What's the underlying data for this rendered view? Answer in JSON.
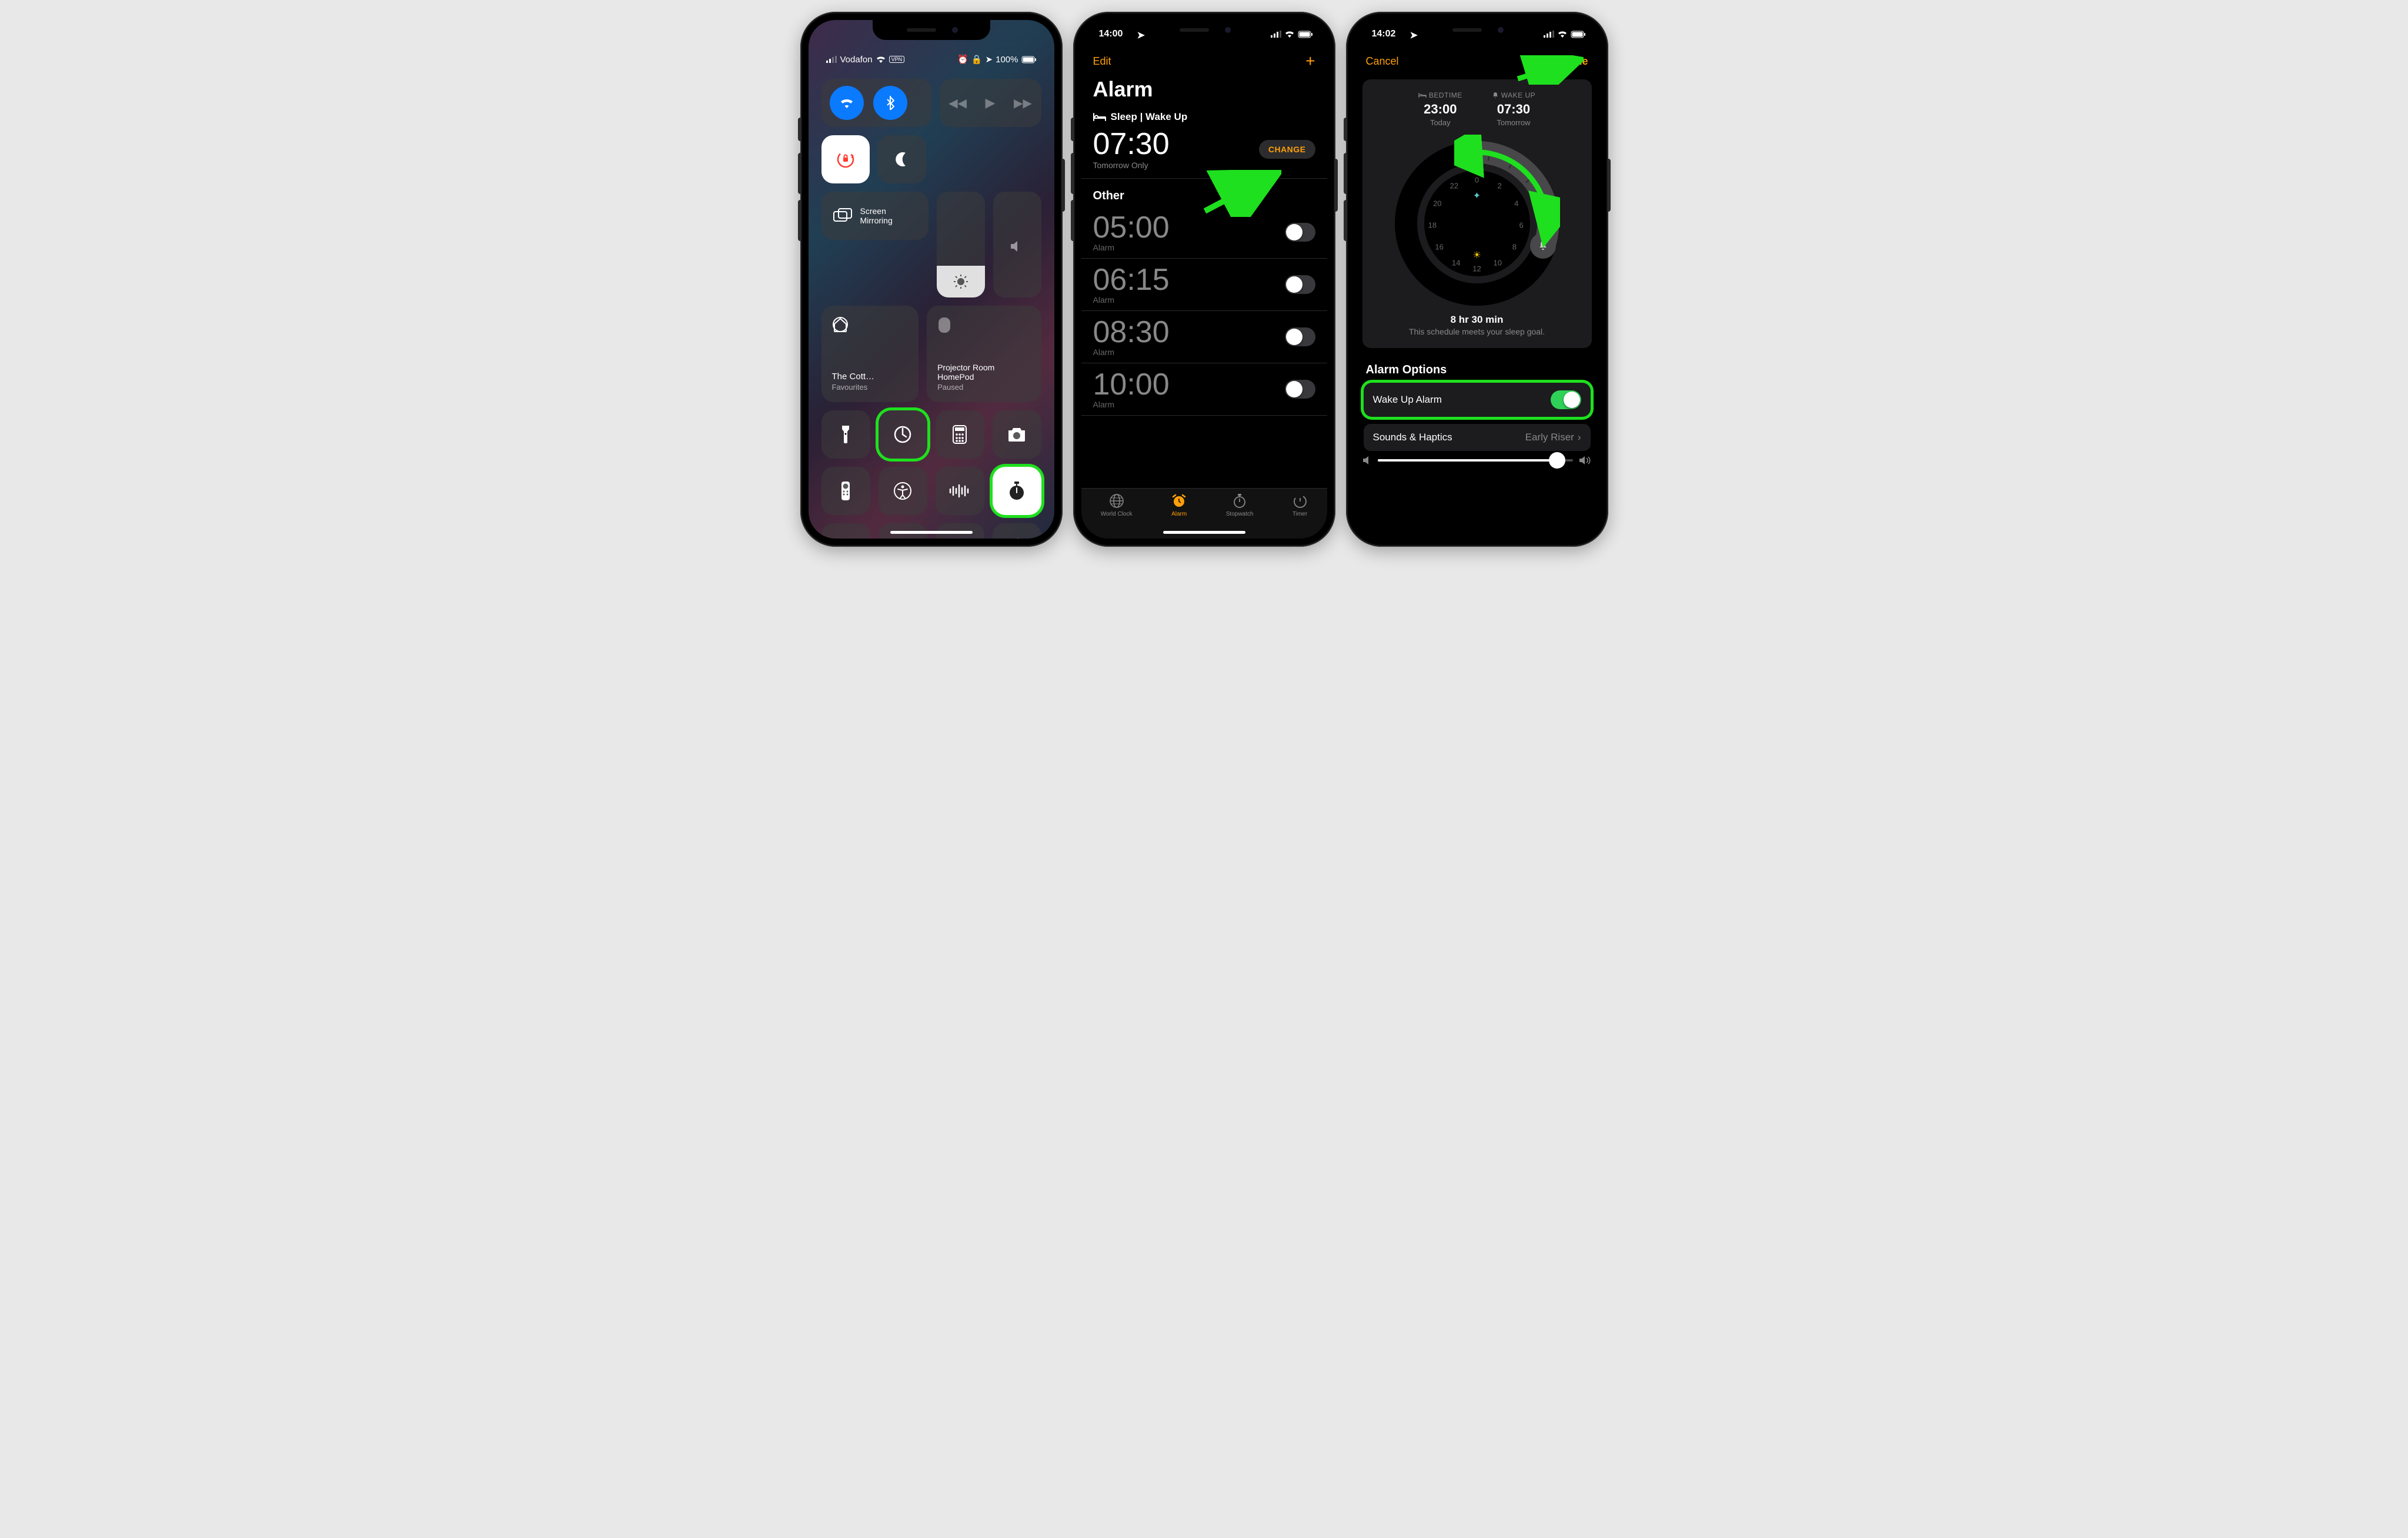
{
  "phone1": {
    "status": {
      "carrier": "Vodafon",
      "vpn": "VPN",
      "battery": "100%"
    },
    "screen_mirroring_label": "Screen\nMirroring",
    "home": {
      "name": "The Cott…",
      "sub": "Favourites"
    },
    "homepod": {
      "name": "Projector Room HomePod",
      "sub": "Paused"
    }
  },
  "phone2": {
    "status_time": "14:00",
    "nav": {
      "edit": "Edit"
    },
    "title": "Alarm",
    "wake_section": "Sleep | Wake Up",
    "wake": {
      "time": "07:30",
      "sub": "Tomorrow Only",
      "change": "CHANGE"
    },
    "other_label": "Other",
    "alarms": [
      {
        "time": "05:00",
        "label": "Alarm"
      },
      {
        "time": "06:15",
        "label": "Alarm"
      },
      {
        "time": "08:30",
        "label": "Alarm"
      },
      {
        "time": "10:00",
        "label": "Alarm"
      }
    ],
    "tabs": {
      "world": "World Clock",
      "alarm": "Alarm",
      "stopwatch": "Stopwatch",
      "timer": "Timer"
    }
  },
  "phone3": {
    "status_time": "14:02",
    "nav": {
      "cancel": "Cancel",
      "done": "Done"
    },
    "bedtime": {
      "label": "BEDTIME",
      "time": "23:00",
      "sub": "Today"
    },
    "wakeup": {
      "label": "WAKE UP",
      "time": "07:30",
      "sub": "Tomorrow"
    },
    "clock_nums": [
      "0",
      "2",
      "4",
      "6",
      "8",
      "10",
      "12",
      "14",
      "16",
      "18",
      "20",
      "22"
    ],
    "goal": {
      "duration": "8 hr 30 min",
      "text": "This schedule meets your sleep goal."
    },
    "options_header": "Alarm Options",
    "options": {
      "wake_alarm": "Wake Up Alarm",
      "sounds": "Sounds & Haptics",
      "sounds_val": "Early Riser"
    }
  }
}
